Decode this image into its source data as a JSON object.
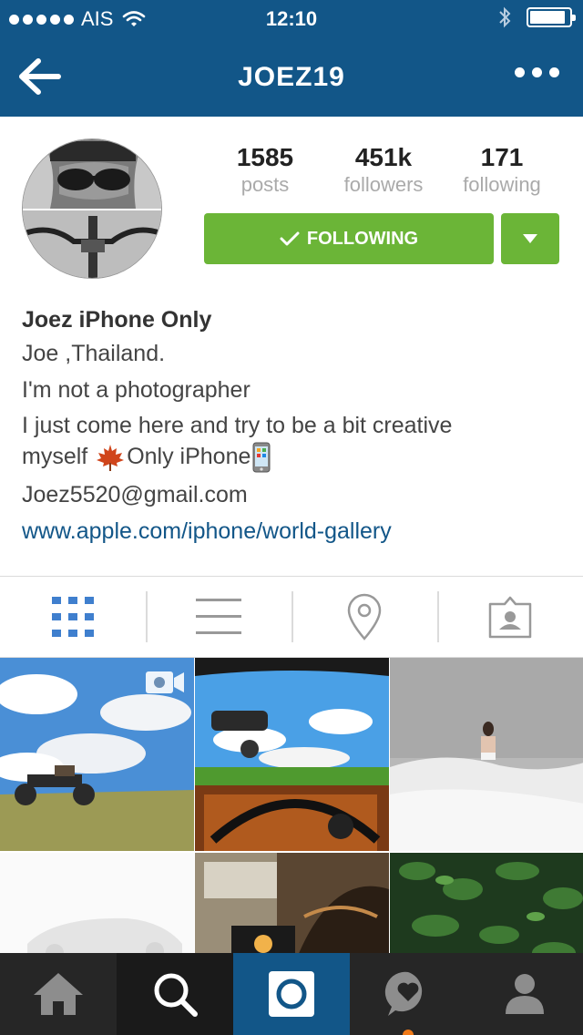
{
  "status_bar": {
    "carrier": "AIS",
    "time": "12:10",
    "battery_level": 0.9
  },
  "nav": {
    "title": "JOEZ19",
    "back_icon": "arrow-left-icon",
    "more_icon": "more-dots-icon"
  },
  "profile": {
    "stats": [
      {
        "value": "1585",
        "label": "posts"
      },
      {
        "value": "451k",
        "label": "followers"
      },
      {
        "value": "171",
        "label": "following"
      }
    ],
    "follow_button": "FOLLOWING",
    "bio": {
      "name": "Joez iPhone Only",
      "line1": "Joe ,Thailand.",
      "line2": "I'm not a photographer",
      "line3a": "I just come here and try to be a bit creative",
      "line3b_prefix": "myself ",
      "line3b_suffix": "Only iPhone",
      "email": "Joez5520@gmail.com",
      "website": "www.apple.com/iphone/world-gallery"
    }
  },
  "tabs": [
    {
      "icon": "grid-icon",
      "active": true
    },
    {
      "icon": "list-icon",
      "active": false
    },
    {
      "icon": "location-pin-icon",
      "active": false
    },
    {
      "icon": "tagged-photos-icon",
      "active": false
    }
  ],
  "bottom_bar": [
    {
      "icon": "home-icon"
    },
    {
      "icon": "search-icon"
    },
    {
      "icon": "camera-icon"
    },
    {
      "icon": "activity-heart-icon"
    },
    {
      "icon": "profile-icon"
    }
  ],
  "colors": {
    "header": "#125688",
    "follow_green": "#6bb537",
    "link_blue": "#125688",
    "tab_active": "#3f7fce",
    "tabbar_bg": "#262626"
  }
}
